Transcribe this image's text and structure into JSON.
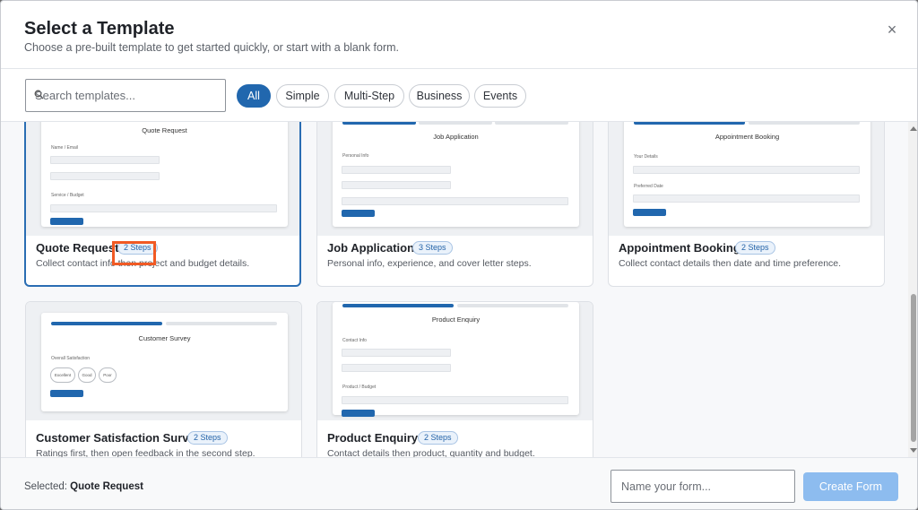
{
  "dialog": {
    "title": "Select a Template",
    "subtitle": "Choose a pre-built template to get started quickly, or start with a blank form.",
    "close_icon": "close-icon",
    "close_glyph": "×"
  },
  "search": {
    "placeholder": "Search templates...",
    "value": "",
    "icon": "search-icon"
  },
  "filters": [
    {
      "label": "All",
      "active": true
    },
    {
      "label": "Simple",
      "active": false
    },
    {
      "label": "Multi-Step",
      "active": false
    },
    {
      "label": "Business",
      "active": false
    },
    {
      "label": "Events",
      "active": false
    }
  ],
  "templates": [
    {
      "name": "Quote Request",
      "steps": "2 Steps",
      "description": "Collect contact info then project and budget details.",
      "selected": true,
      "preview": {
        "title": "Quote Request",
        "label1": "Name / Email",
        "label2": "Service / Budget"
      }
    },
    {
      "name": "Job Application",
      "steps": "3 Steps",
      "description": "Personal info, experience, and cover letter steps.",
      "selected": false,
      "preview": {
        "title": "Job Application",
        "label1": "Personal Info"
      }
    },
    {
      "name": "Appointment Booking",
      "steps": "2 Steps",
      "description": "Collect contact details then date and time preference.",
      "selected": false,
      "preview": {
        "title": "Appointment Booking",
        "label1": "Your Details",
        "label2": "Preferred Date"
      }
    },
    {
      "name": "Customer Satisfaction Survey",
      "steps": "2 Steps",
      "description": "Ratings first, then open feedback in the second step.",
      "selected": false,
      "preview": {
        "title": "Customer Survey",
        "label1": "Overall Satisfaction",
        "options": [
          "Excellent",
          "Good",
          "Poor"
        ]
      }
    },
    {
      "name": "Product Enquiry",
      "steps": "2 Steps",
      "description": "Contact details then product, quantity and budget.",
      "selected": false,
      "preview": {
        "title": "Product Enquiry",
        "label1": "Contact Info",
        "label2": "Product / Budget"
      }
    }
  ],
  "highlight_color": "#f15a24",
  "accent_color": "#2167ae",
  "footer": {
    "selected_prefix": "Selected:",
    "selected_name": "Quote Request",
    "name_placeholder": "Name your form...",
    "name_value": "",
    "create_label": "Create Form"
  }
}
